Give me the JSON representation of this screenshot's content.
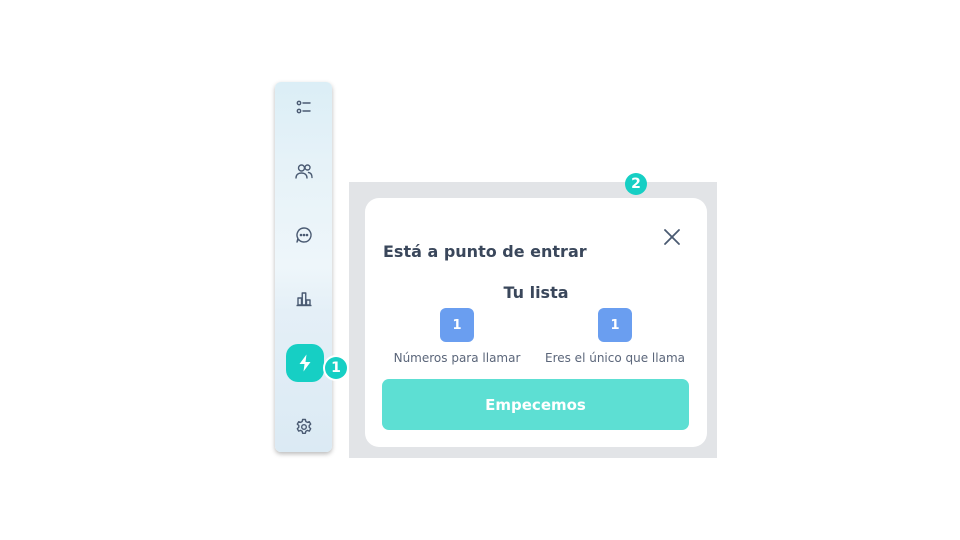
{
  "sidebar": {
    "items": [
      {
        "icon": "list-icon"
      },
      {
        "icon": "users-icon"
      },
      {
        "icon": "chat-icon"
      },
      {
        "icon": "bar-chart-icon"
      },
      {
        "icon": "flash-icon",
        "active": true
      },
      {
        "icon": "gear-icon"
      }
    ],
    "accent_color": "#16cfc4"
  },
  "badges": {
    "step_1": "1",
    "step_2": "2"
  },
  "modal": {
    "title": "Está a punto de entrar",
    "list_title": "Tu lista",
    "stats": [
      {
        "value": "1",
        "label": "Números para llamar"
      },
      {
        "value": "1",
        "label": "Eres el único que llama"
      }
    ],
    "start_button": "Empecemos",
    "button_color": "#5ddfd3",
    "stat_color": "#6a9ef0"
  }
}
